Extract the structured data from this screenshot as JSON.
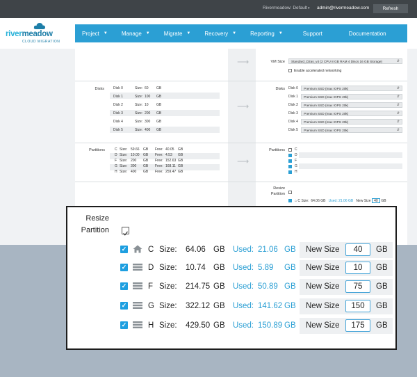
{
  "topbar": {
    "tenant": "Rivermeadow: Default",
    "user": "admin@rivermeadow.com",
    "refresh_label": "Refresh"
  },
  "logo": {
    "name_part1": "river",
    "name_part2": "meadow",
    "subtitle": "CLOUD MIGRATION"
  },
  "nav": {
    "project": "Project",
    "manage": "Manage",
    "migrate": "Migrate",
    "recovery": "Recovery",
    "reporting": "Reporting",
    "support": "Support",
    "documentation": "Documentation"
  },
  "colors": {
    "accent": "#2b9fd4",
    "topbar": "#3f4448",
    "used": "#2b9fd4",
    "checkbox": "#1e9fe0",
    "backdrop": "#a8b5c2"
  },
  "vm": {
    "label": "VM Size",
    "value": "Standard_D2as_v4  (2 CPU 8 GB RAM 4 Discs 16 GB Storage)",
    "accel_label": "Enable accelerated networking"
  },
  "disks": {
    "label": "Disks",
    "size_label": "Size:",
    "unit": "GB",
    "rows": [
      {
        "name": "Disk 0",
        "size": "60"
      },
      {
        "name": "Disk 1",
        "size": "100"
      },
      {
        "name": "Disk 2",
        "size": "10"
      },
      {
        "name": "Disk 3",
        "size": "200"
      },
      {
        "name": "Disk 4",
        "size": "300"
      },
      {
        "name": "Disk 5",
        "size": "400"
      }
    ],
    "target_type": "Premium SSD (max IOPS 20k)"
  },
  "partitions": {
    "label": "Partitions",
    "size_label": "Size:",
    "free_label": "Free:",
    "unit": "GB",
    "rows": [
      {
        "letter": "C",
        "size": "59.66",
        "free": "40.05"
      },
      {
        "letter": "D",
        "size": "10.00",
        "free": "4.53"
      },
      {
        "letter": "F",
        "size": "200",
        "free": "152.63"
      },
      {
        "letter": "G",
        "size": "300",
        "free": "168.11"
      },
      {
        "letter": "H",
        "size": "400",
        "free": "259.47"
      }
    ]
  },
  "resize": {
    "label_line1": "Resize",
    "label_line2": "Partition",
    "size_label": "Size:",
    "used_label": "Used:",
    "new_size_label": "New Size",
    "unit": "GB",
    "rows": [
      {
        "letter": "C",
        "icon": "home-icon",
        "size": "64.06",
        "used": "21.06",
        "new_size": "40"
      },
      {
        "letter": "D",
        "icon": "drive-icon",
        "size": "10.74",
        "used": "5.89",
        "new_size": "10"
      },
      {
        "letter": "F",
        "icon": "drive-icon",
        "size": "214.75",
        "used": "50.89",
        "new_size": "75"
      },
      {
        "letter": "G",
        "icon": "drive-icon",
        "size": "322.12",
        "used": "141.62",
        "new_size": "150"
      },
      {
        "letter": "H",
        "icon": "drive-icon",
        "size": "429.50",
        "used": "150.89",
        "new_size": "175"
      }
    ]
  }
}
